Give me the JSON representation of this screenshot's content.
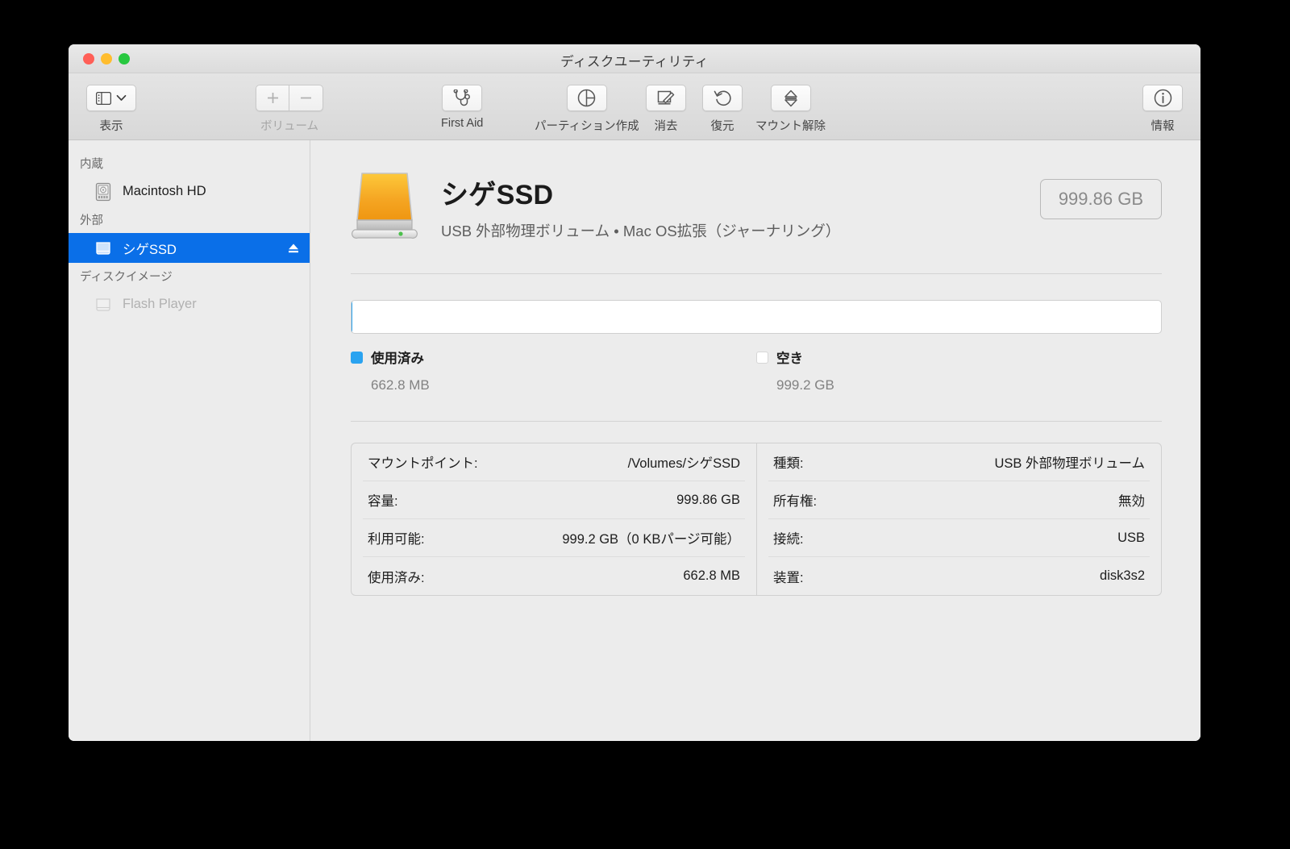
{
  "window": {
    "title": "ディスクユーティリティ",
    "traffic_lights": [
      {
        "name": "close",
        "color": "#ff5f57"
      },
      {
        "name": "minimize",
        "color": "#ffbd2e"
      },
      {
        "name": "zoom",
        "color": "#28c840"
      }
    ]
  },
  "toolbar": {
    "view": {
      "label": "表示",
      "icon": "sidebar-icon",
      "chevron": "chevron-down-icon"
    },
    "volume": {
      "label": "ボリューム",
      "add_icon": "plus-icon",
      "remove_icon": "minus-icon",
      "enabled": false
    },
    "items": [
      {
        "label": "First Aid",
        "icon": "stethoscope-icon"
      },
      {
        "label": "パーティション作成",
        "icon": "pie-chart-icon"
      },
      {
        "label": "消去",
        "icon": "eraser-icon"
      },
      {
        "label": "復元",
        "icon": "undo-arrow-icon"
      },
      {
        "label": "マウント解除",
        "icon": "unmount-icon"
      }
    ],
    "info": {
      "label": "情報",
      "icon": "info-circle-icon"
    }
  },
  "sidebar": {
    "sections": [
      {
        "header": "内蔵",
        "items": [
          {
            "label": "Macintosh HD",
            "icon": "internal-drive-icon",
            "selected": false,
            "disabled": false,
            "eject": false
          }
        ]
      },
      {
        "header": "外部",
        "items": [
          {
            "label": "シゲSSD",
            "icon": "external-drive-icon",
            "selected": true,
            "disabled": false,
            "eject": true
          }
        ]
      },
      {
        "header": "ディスクイメージ",
        "items": [
          {
            "label": "Flash Player",
            "icon": "disk-image-icon",
            "selected": false,
            "disabled": true,
            "eject": false
          }
        ]
      }
    ],
    "selection_color": "#0a6fe8"
  },
  "volume": {
    "name": "シゲSSD",
    "subtitle": "USB 外部物理ボリューム • Mac OS拡張（ジャーナリング）",
    "capacity_badge": "999.86 GB",
    "icon": "external-hard-drive-icon"
  },
  "usage": {
    "used_percent": 0.066,
    "legend": [
      {
        "key": "used",
        "label": "使用済み",
        "value": "662.8 MB",
        "color": "#2aa3f0"
      },
      {
        "key": "free",
        "label": "空き",
        "value": "999.2 GB",
        "color": "#ffffff"
      }
    ]
  },
  "info": {
    "left": [
      {
        "key": "マウントポイント:",
        "value": "/Volumes/シゲSSD"
      },
      {
        "key": "容量:",
        "value": "999.86 GB"
      },
      {
        "key": "利用可能:",
        "value": "999.2 GB（0 KBパージ可能）"
      },
      {
        "key": "使用済み:",
        "value": "662.8 MB"
      }
    ],
    "right": [
      {
        "key": "種類:",
        "value": "USB 外部物理ボリューム"
      },
      {
        "key": "所有権:",
        "value": "無効"
      },
      {
        "key": "接続:",
        "value": "USB"
      },
      {
        "key": "装置:",
        "value": "disk3s2"
      }
    ]
  }
}
